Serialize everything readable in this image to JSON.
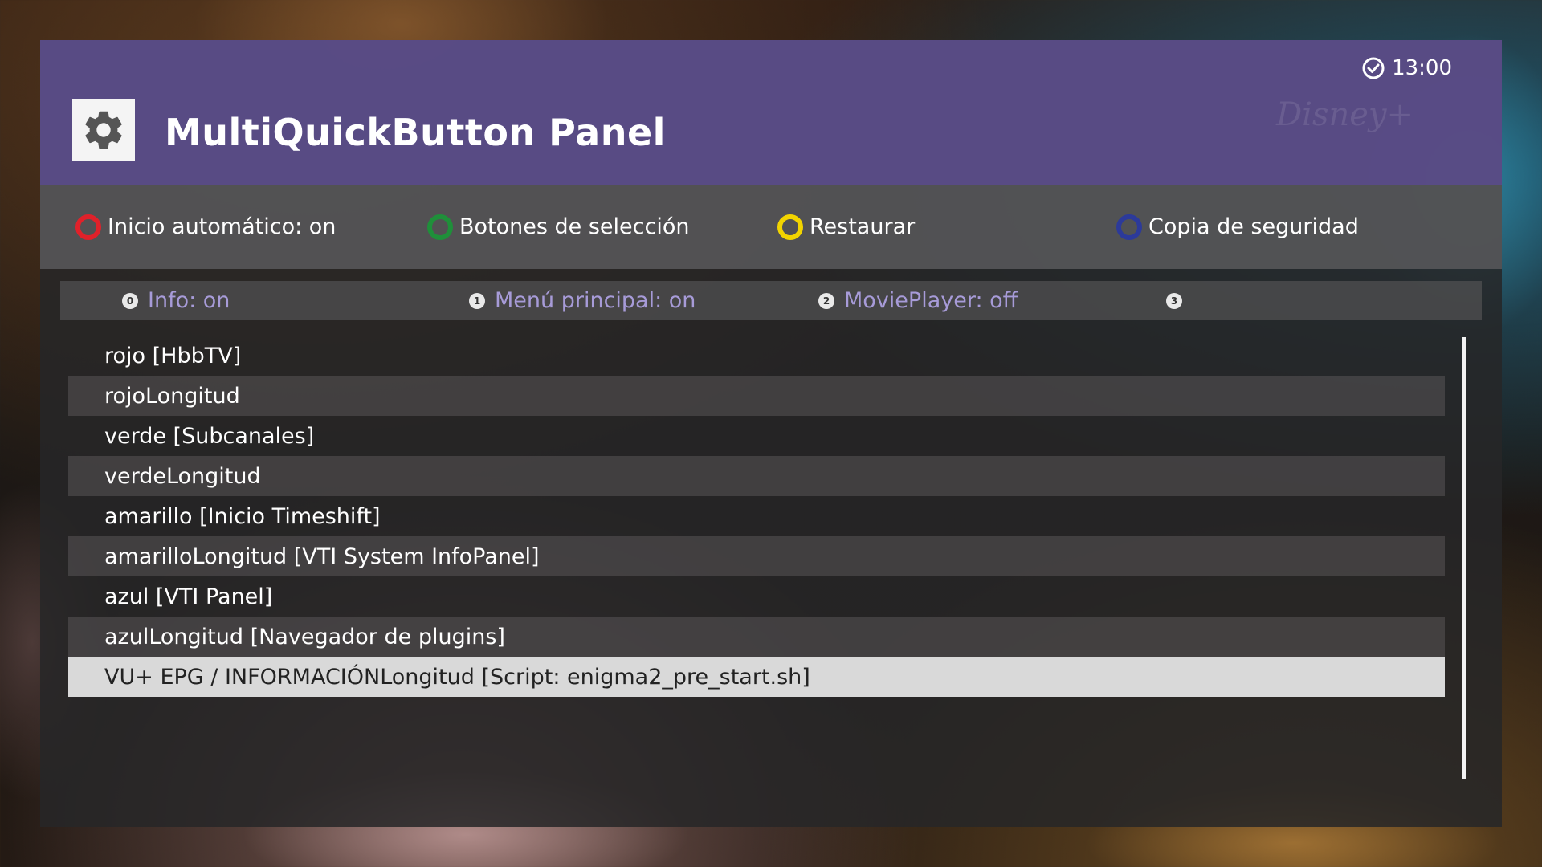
{
  "header": {
    "title": "MultiQuickButton Panel",
    "clock": "13:00",
    "watermark": "Disney+"
  },
  "color_buttons": [
    {
      "label": "Inicio automático: on",
      "color": "#e0212a"
    },
    {
      "label": "Botones de selección",
      "color": "#1f8f3a"
    },
    {
      "label": "Restaurar",
      "color": "#f2d400"
    },
    {
      "label": "Copia de seguridad",
      "color": "#2c3a9a"
    }
  ],
  "number_options": [
    {
      "key": "0",
      "label": "Info: on"
    },
    {
      "key": "1",
      "label": "Menú principal: on"
    },
    {
      "key": "2",
      "label": "MoviePlayer: off"
    },
    {
      "key": "3",
      "label": ""
    }
  ],
  "list": {
    "items": [
      "rojo [HbbTV]",
      "rojoLongitud",
      "verde [Subcanales]",
      "verdeLongitud",
      "amarillo [Inicio Timeshift]",
      "amarilloLongitud [VTI System InfoPanel]",
      "azul [VTI Panel]",
      "azulLongitud [Navegador de plugins]",
      "VU+ EPG / INFORMACIÓNLongitud [Script: enigma2_pre_start.sh]"
    ],
    "selected_index": 8
  },
  "icons": {
    "settings": "gear-icon",
    "clock": "clock-icon"
  }
}
